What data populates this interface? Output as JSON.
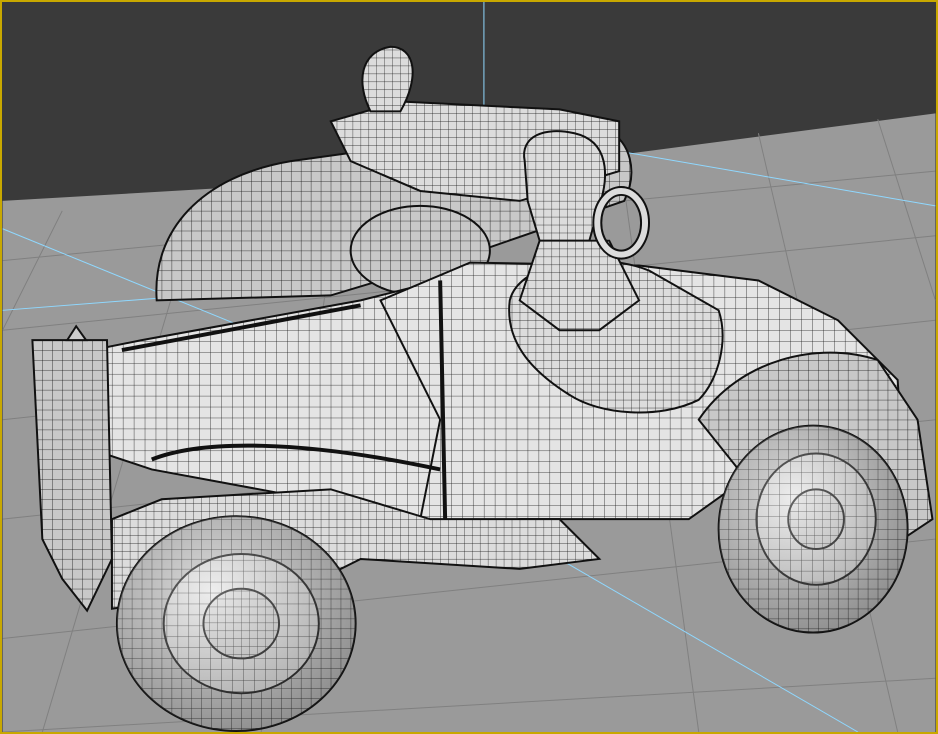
{
  "viewport": {
    "active_border_color": "#c8a800",
    "background_color": "#3a3a3a",
    "ground_color": "#9a9a9a",
    "grid_line_color": "#7f7f7f",
    "axis_color": "#8fd8ff",
    "mesh_fill_color": "#e2e2e2",
    "wire_color": "#1a1a1a",
    "shading_mode": "smooth-shaded-with-wireframe-edges",
    "object_icon": "toy-car-icon"
  }
}
